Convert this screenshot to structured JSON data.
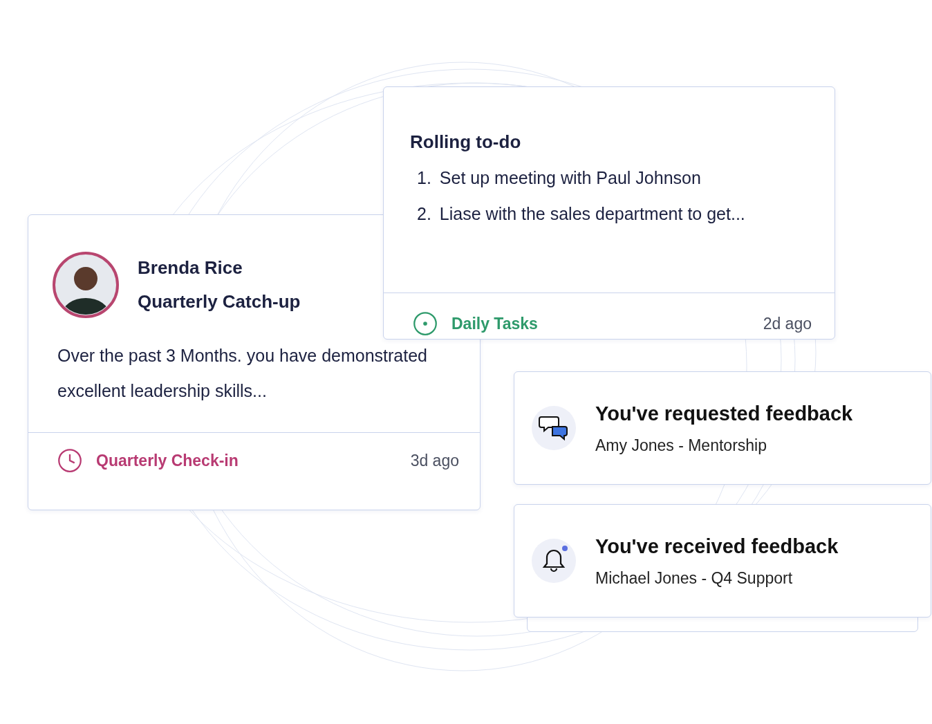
{
  "checkin_card": {
    "name": "Brenda Rice",
    "subject": "Quarterly Catch-up",
    "summary": "Over the past 3 Months. you have demonstrated excellent leadership skills...",
    "tag": {
      "label": "Quarterly Check-in",
      "color": "#b83a72",
      "kind": "clock"
    },
    "time": "3d ago"
  },
  "todo_card": {
    "title": "Rolling to-do",
    "items": [
      {
        "number": "1.",
        "text": "Set up meeting with Paul Johnson"
      },
      {
        "number": "2.",
        "text": "Liase with the sales department to get..."
      }
    ],
    "tag": {
      "label": "Daily Tasks",
      "color": "#2e9a6b",
      "kind": "target"
    },
    "time": "2d ago"
  },
  "notifications": [
    {
      "kind": "chat",
      "title": "You've requested feedback",
      "detail": "Amy Jones - Mentorship",
      "unread": false
    },
    {
      "kind": "bell",
      "title": "You've received feedback",
      "detail": "Michael Jones - Q4 Support",
      "unread": true
    }
  ]
}
